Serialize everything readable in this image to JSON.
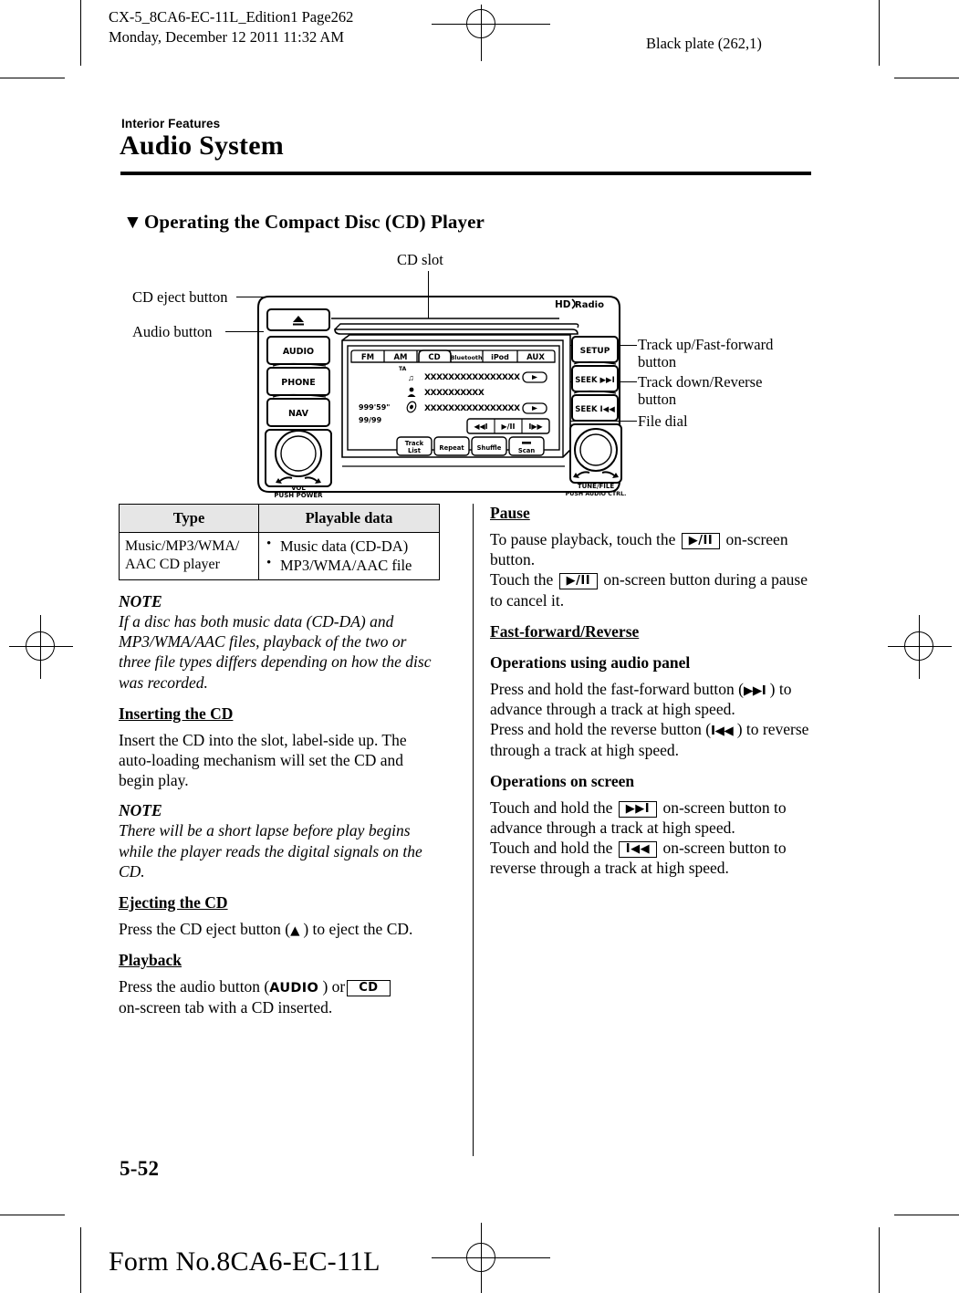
{
  "header": {
    "left": "CX-5_8CA6-EC-11L_Edition1 Page262\nMonday, December 12 2011 11:32 AM",
    "right": "Black plate (262,1)"
  },
  "masthead": {
    "kicker": "Interior Features",
    "title": "Audio System"
  },
  "heading": {
    "bullet": "▼",
    "text": "Operating the Compact Disc (CD) Player"
  },
  "diagram": {
    "callouts": {
      "cd_slot": "CD slot",
      "cd_eject_button": "CD eject button",
      "audio_button": "Audio button",
      "track_up": "Track up/Fast-forward\nbutton",
      "track_down": "Track down/Reverse\nbutton",
      "file_dial": "File dial"
    },
    "panel_buttons": {
      "eject": "▲",
      "audio": "AUDIO",
      "phone": "PHONE",
      "nav": "NAV",
      "setup": "SETUP",
      "seek_fwd": "SEEK ▶▶I",
      "seek_rev": "SEEK I◀◀",
      "vol_line1": "VOL",
      "vol_line2": "PUSH POWER",
      "tune_line1": "TUNE/FILE",
      "tune_line2": "PUSH AUDIO CTRL.",
      "hd_radio": "Radio",
      "hd_logo": "HD"
    },
    "screen": {
      "tabs": [
        "FM",
        "AM",
        "CD",
        "Bluetooth",
        "iPod",
        "AUX"
      ],
      "active_tab": "CD",
      "ta_indicator": "TA",
      "time": "999'59\"",
      "track_count": "99/99",
      "row1_text": "XXXXXXXXXXXXXXXX",
      "row2_text": "XXXXXXXXXX",
      "row3_text": "XXXXXXXXXXXXXXXX",
      "transport": [
        "◀◀I",
        "▶/II",
        "I▶▶"
      ],
      "soft_buttons": [
        "Track List",
        "Repeat",
        "Shuffle",
        "Scan"
      ]
    }
  },
  "table": {
    "headers": [
      "Type",
      "Playable data"
    ],
    "rows": [
      {
        "type": "Music/MP3/WMA/\nAAC CD player",
        "playable": [
          "Music data (CD-DA)",
          "MP3/WMA/AAC file"
        ]
      }
    ]
  },
  "left_column": {
    "note1_title": "NOTE",
    "note1_body": "If a disc has both music data (CD-DA) and MP3/WMA/AAC files, playback of the two or three file types differs depending on how the disc was recorded.",
    "inserting_title": "Inserting the CD",
    "inserting_body": "Insert the CD into the slot, label-side up. The auto-loading mechanism will set the CD and begin play.",
    "note2_title": "NOTE",
    "note2_body": "There will be a short lapse before play begins while the player reads the digital signals on the CD.",
    "ejecting_title": "Ejecting the CD",
    "ejecting_body_1": "Press the CD eject button (",
    "ejecting_glyph": "▲",
    "ejecting_body_2": ") to eject the CD.",
    "playback_title": "Playback",
    "playback_body_1": "Press the audio button (",
    "playback_audio_glyph": "AUDIO",
    "playback_body_2": ") or",
    "playback_cd_tab": "CD",
    "playback_body_3": "on-screen tab with a CD inserted."
  },
  "right_column": {
    "pause_title": "Pause",
    "pause_body_1": "To pause playback, touch the",
    "pause_glyph_1": "▶/II",
    "pause_body_2": "on-screen button.",
    "pause_body_3": "Touch the",
    "pause_glyph_2": "▶/II",
    "pause_body_4": "on-screen button during a pause to cancel it.",
    "ff_title": "Fast-forward/Reverse",
    "panel_ops_title": "Operations using audio panel",
    "panel_body_1": "Press and hold the fast-forward button (",
    "panel_glyph_1": "▶▶I",
    "panel_body_2": ") to advance through a track at high speed.",
    "panel_body_3": "Press and hold the reverse button (",
    "panel_glyph_2": "I◀◀",
    "panel_body_4": ") to reverse through a track at high speed.",
    "screen_ops_title": "Operations on screen",
    "screen_body_1": "Touch and hold the",
    "screen_glyph_1": "▶▶I",
    "screen_body_2": "on-screen button to advance through a track at high speed.",
    "screen_body_3": "Touch and hold the",
    "screen_glyph_2": "I◀◀",
    "screen_body_4": "on-screen button to reverse through a track at high speed."
  },
  "footer": {
    "page_number": "5-52",
    "form_number": "Form No.8CA6-EC-11L"
  }
}
